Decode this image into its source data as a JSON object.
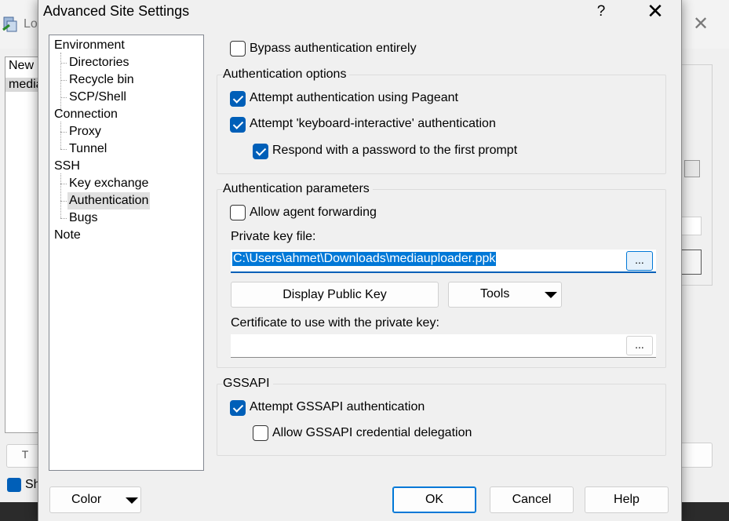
{
  "background_window": {
    "title": "Lo",
    "sites": [
      "New S",
      "media"
    ],
    "show_label": "Sh",
    "small_button_label": "T"
  },
  "dialog": {
    "title": "Advanced Site Settings",
    "help_label": "?",
    "close_label": "✕"
  },
  "tree": {
    "items": [
      {
        "label": "Environment",
        "level": 0
      },
      {
        "label": "Directories",
        "level": 1
      },
      {
        "label": "Recycle bin",
        "level": 1
      },
      {
        "label": "SCP/Shell",
        "level": 1
      },
      {
        "label": "Connection",
        "level": 0
      },
      {
        "label": "Proxy",
        "level": 1
      },
      {
        "label": "Tunnel",
        "level": 1
      },
      {
        "label": "SSH",
        "level": 0
      },
      {
        "label": "Key exchange",
        "level": 1
      },
      {
        "label": "Authentication",
        "level": 1,
        "selected": true
      },
      {
        "label": "Bugs",
        "level": 1
      },
      {
        "label": "Note",
        "level": 0
      }
    ]
  },
  "auth": {
    "bypass": {
      "label": "Bypass authentication entirely",
      "checked": false
    },
    "options_group": "Authentication options",
    "pageant": {
      "label": "Attempt authentication using Pageant",
      "checked": true
    },
    "keyboard_interactive": {
      "label": "Attempt 'keyboard-interactive' authentication",
      "checked": true
    },
    "respond_password": {
      "label": "Respond with a password to the first prompt",
      "checked": true
    },
    "params_group": "Authentication parameters",
    "agent_forwarding": {
      "label": "Allow agent forwarding",
      "checked": false
    },
    "private_key_label": "Private key file:",
    "private_key_value": "C:\\Users\\ahmet\\Downloads\\mediauploader.ppk",
    "browse_label": "...",
    "display_public_key_label": "Display Public Key",
    "tools_label": "Tools",
    "certificate_label": "Certificate to use with the private key:",
    "certificate_value": "",
    "gssapi_group": "GSSAPI",
    "gssapi_attempt": {
      "label": "Attempt GSSAPI authentication",
      "checked": true
    },
    "gssapi_delegation": {
      "label": "Allow GSSAPI credential delegation",
      "checked": false
    }
  },
  "footer": {
    "color_label": "Color",
    "ok_label": "OK",
    "cancel_label": "Cancel",
    "help_label": "Help"
  },
  "colors": {
    "accent": "#005fb8",
    "selection": "#0078d7"
  }
}
